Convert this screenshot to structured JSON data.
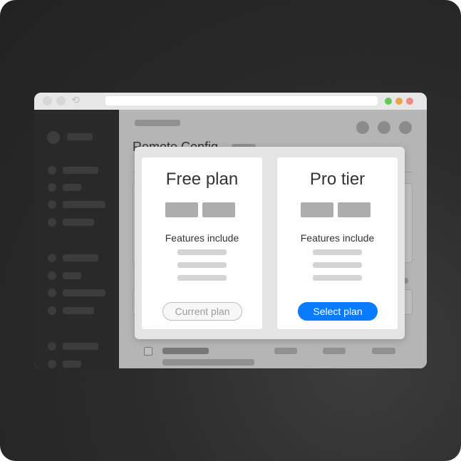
{
  "page": {
    "title": "Remote Config"
  },
  "modal": {
    "plans": [
      {
        "name": "Free plan",
        "features_label": "Features include",
        "button_label": "Current plan"
      },
      {
        "name": "Pro tier",
        "features_label": "Features include",
        "button_label": "Select plan"
      }
    ]
  },
  "colors": {
    "accent": "#0a7bff",
    "traffic_green": "#5fc95b",
    "traffic_yellow": "#e9a64a",
    "traffic_red": "#ee8a84",
    "sidebar": "#2a2a2a"
  },
  "icons": {
    "reload": "reload-icon"
  }
}
